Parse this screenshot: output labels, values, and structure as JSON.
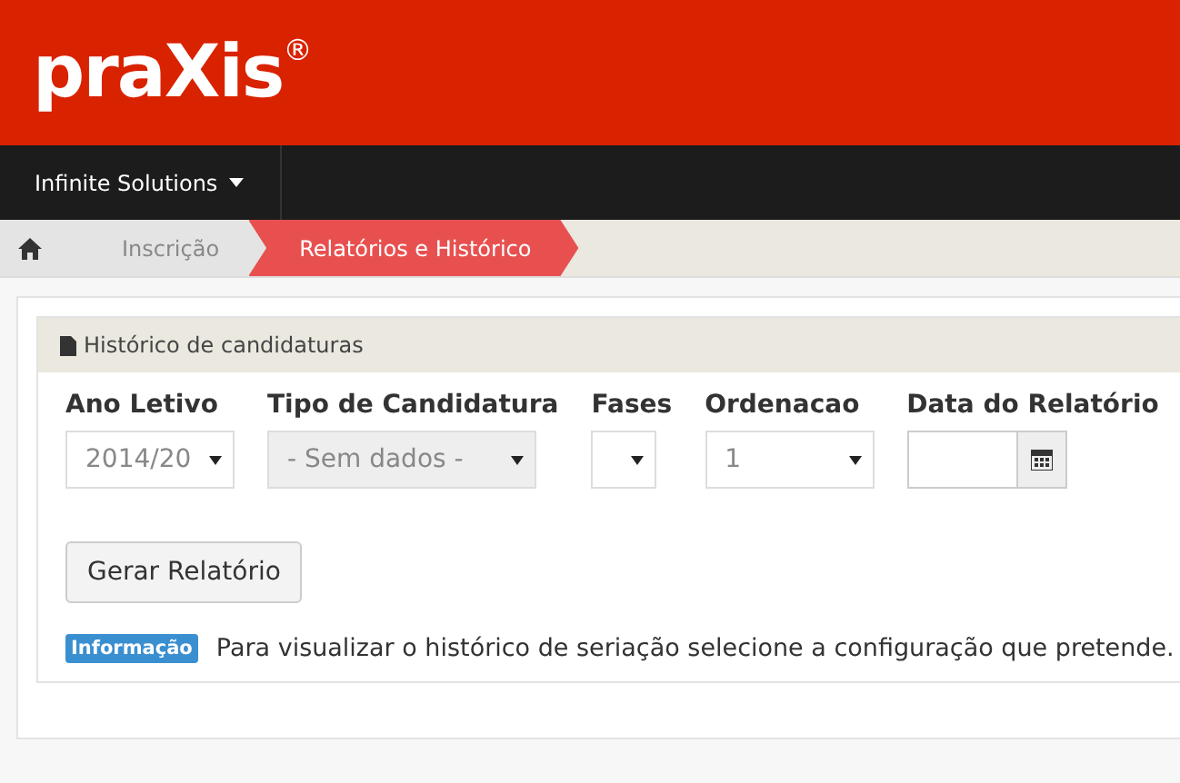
{
  "logo": "praXis$^{®}$",
  "nav": {
    "label": "Infinite Solutions"
  },
  "breadcrumb": [
    {
      "kind": "home",
      "selected": false
    },
    {
      "kind": "text",
      "label": "Inscrição",
      "selected": false
    },
    {
      "kind": "text",
      "label": "Relatórios e Histórico",
      "selected": true
    }
  ],
  "panel": {
    "title": "Histórico de candidaturas",
    "fields": [
      {
        "kind": "select",
        "label": "Ano Letivo",
        "value": "2014/20",
        "disabled": false
      },
      {
        "kind": "select",
        "label": "Tipo de Candidatura",
        "value": "- Sem dados -",
        "disabled": true
      },
      {
        "kind": "select",
        "label": "Fases",
        "disabled": false
      },
      {
        "kind": "select",
        "label": "Ordenacao",
        "value": "1",
        "disabled": false
      },
      {
        "kind": "date",
        "label": "Data do Relatório",
        "disabled": false
      }
    ],
    "button": "Gerar Relatório",
    "badge": "Informação",
    "message": "Para visualizar o histórico de seriação selecione a configuração que pretende."
  }
}
